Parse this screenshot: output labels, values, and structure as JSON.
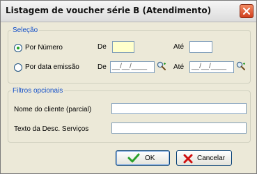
{
  "window": {
    "title": "Listagem de voucher série B (Atendimento)"
  },
  "selection": {
    "legend": "Seleção",
    "options": [
      {
        "label": "Por Número",
        "selected": true
      },
      {
        "label": "Por data emissão",
        "selected": false
      }
    ],
    "from_label": "De",
    "to_label": "Até",
    "number_from": "",
    "number_to": "",
    "date_from": "__/__/____",
    "date_to": "__/__/____"
  },
  "filters": {
    "legend": "Filtros opcionais",
    "customer_name_label": "Nome do cliente (parcial)",
    "customer_name": "",
    "service_desc_label": "Texto da Desc. Serviços",
    "service_desc": ""
  },
  "buttons": {
    "ok": "OK",
    "cancel": "Cancelar"
  },
  "colors": {
    "legend": "#1551c9",
    "ok_icon": "#2aa02a",
    "cancel_icon": "#d01010",
    "focused_input": "#ffffcc"
  }
}
